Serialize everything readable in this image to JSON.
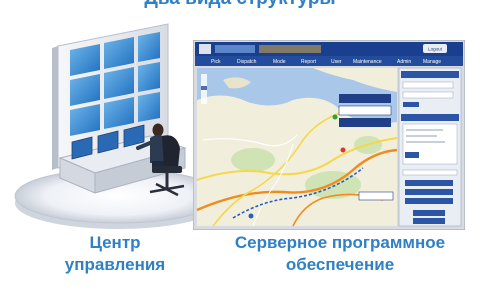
{
  "heading_partial": "Два вида структуры",
  "captions": {
    "left": [
      "Центр",
      "управления"
    ],
    "right": [
      "Серверное программное",
      "обеспечение"
    ]
  },
  "software_screen": {
    "menu_items": [
      "Pick",
      "Dispatch",
      "Mode",
      "Report",
      "User",
      "Maintenance",
      "Admin",
      "Manage"
    ],
    "logout_label": "Logout"
  },
  "colors": {
    "caption_blue": "#2f80c5",
    "screen_bar_blue": "#1a3f8f",
    "map_sea": "#a9c7e8",
    "map_land": "#f1eedc",
    "route_orange": "#f08c1e",
    "route_yellow": "#f5d84a"
  }
}
